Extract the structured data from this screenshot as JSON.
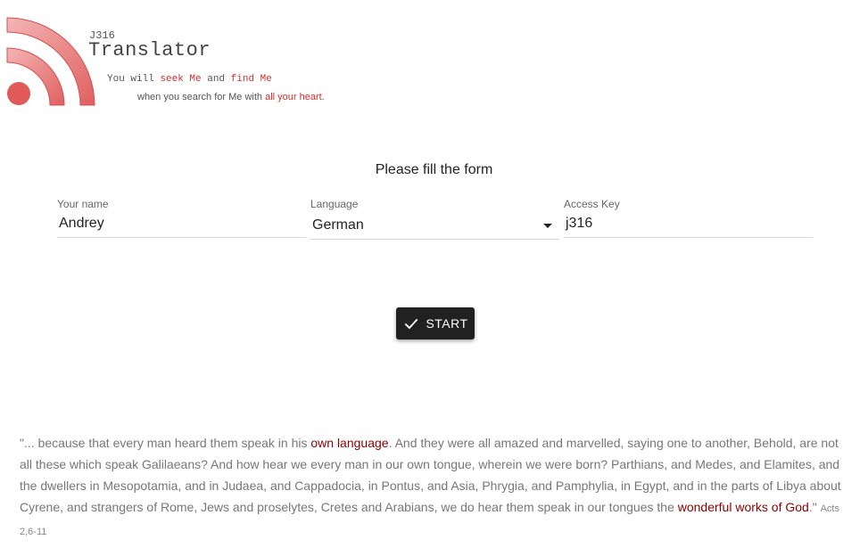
{
  "brand": {
    "small": "J316",
    "title": "Translator",
    "tagline1": {
      "part1": "You will ",
      "seek": "seek Me",
      "part2": " and ",
      "find": "find Me"
    },
    "tagline2": {
      "part1": "when you search for Me with ",
      "heart": "all your heart",
      "part2": "."
    }
  },
  "form": {
    "title": "Please fill the form",
    "name": {
      "label": "Your name",
      "value": "Andrey"
    },
    "language": {
      "label": "Language",
      "value": "German"
    },
    "access_key": {
      "label": "Access Key",
      "value": "j316"
    },
    "start_label": "START"
  },
  "quote": {
    "part1": "\"... because that every man heard them speak in his ",
    "own_language": "own language",
    "part2": ". And they were all amazed and marvelled, saying one to another, Behold, are not all these which speak Galilaeans? And how hear we every man in our own tongue, wherein we were born? Parthians, and Medes, and Elamites, and the dwellers in Mesopotamia, and in Judaea, and Cappadocia, in Pontus, and Asia, Phrygia, and Pamphylia, in Egypt, and in the parts of Libya about Cyrene, and strangers of Rome, Jews and proselytes, Cretes and Arabians, we do hear them speak in our tongues the ",
    "wonderful": "wonderful works of God",
    "part3": ".\" ",
    "reference": "Acts 2,6-11"
  },
  "colors": {
    "accent_red": "#d32f2f",
    "quote_highlight": "#8b0000",
    "button_bg": "#212121"
  },
  "icons": {
    "logo": "rss-signal-icon",
    "button": "check-icon",
    "select": "dropdown-arrow-icon"
  }
}
